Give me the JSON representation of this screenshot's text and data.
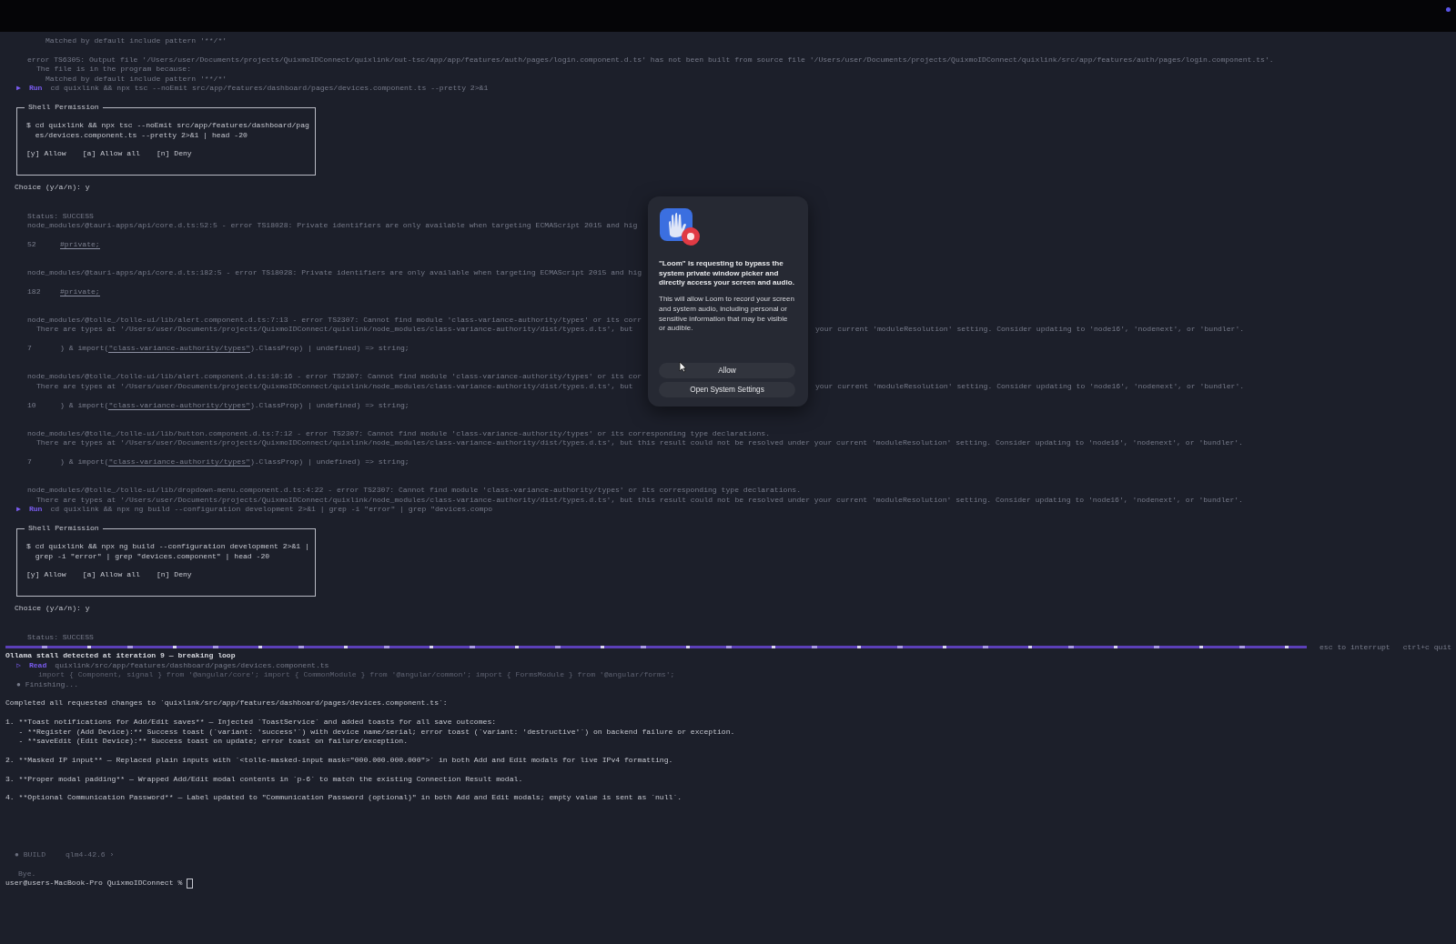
{
  "terminal": {
    "blocks": [
      {
        "kind": "lines",
        "lines": [
          {
            "kind": "out3",
            "text": "Matched by default include pattern '**/*'"
          }
        ]
      },
      {
        "kind": "lines",
        "lines": [
          {
            "kind": "out",
            "text": "error TS6305: Output file '/Users/user/Documents/projects/QuixmoIDConnect/quixlink/out-tsc/app/app/features/auth/pages/login.component.d.ts' has not been built from source file '/Users/user/Documents/projects/QuixmoIDConnect/quixlink/src/app/features/auth/pages/login.component.ts'."
          },
          {
            "kind": "out2",
            "text": "The file is in the program because:"
          },
          {
            "kind": "out3",
            "text": "Matched by default include pattern '**/*'"
          },
          {
            "kind": "run",
            "marker": "▶",
            "label": "Run",
            "text": "cd quixlink && npx tsc --noEmit src/app/features/dashboard/pages/devices.component.ts --pretty 2>&1"
          }
        ]
      },
      {
        "kind": "permission",
        "title": "Shell Permission",
        "command": [
          "$ cd quixlink && npx tsc --noEmit src/app/features/dashboard/pag",
          "  es/devices.component.ts --pretty 2>&1 | head -20"
        ],
        "options": [
          "[y] Allow",
          "[a] Allow all",
          "[n] Deny"
        ],
        "choice": "Choice (y/a/n): y"
      },
      {
        "kind": "lines",
        "lines": [
          {
            "kind": "out",
            "text": "Status: SUCCESS"
          },
          {
            "kind": "out",
            "text": "node_modules/@tauri-apps/api/core.d.ts:52:5 - error TS18028: Private identifiers are only available when targeting ECMAScript 2015 and hig"
          }
        ]
      },
      {
        "kind": "code",
        "lines": [
          {
            "kind": "src",
            "number": "52",
            "mark": "#private;"
          }
        ]
      },
      {
        "kind": "lines",
        "lines": [
          {
            "kind": "out",
            "text": "node_modules/@tauri-apps/api/core.d.ts:182:5 - error TS18028: Private identifiers are only available when targeting ECMAScript 2015 and hig"
          }
        ]
      },
      {
        "kind": "code",
        "lines": [
          {
            "kind": "src",
            "number": "182",
            "mark": "#private;"
          }
        ]
      },
      {
        "kind": "lines",
        "lines": [
          {
            "kind": "out",
            "text": "node_modules/@tolle_/tolle-ui/lib/alert.component.d.ts:7:13 - error TS2307: Cannot find module 'class-variance-authority/types' or its corr"
          },
          {
            "kind": "out2",
            "text": "There are types at '/Users/user/Documents/projects/QuixmoIDConnect/quixlink/node_modules/class-variance-authority/dist/types.d.ts', but",
            "right": "your current 'moduleResolution' setting. Consider updating to 'node16', 'nodenext', or 'bundler'."
          }
        ]
      },
      {
        "kind": "code",
        "lines": [
          {
            "kind": "src",
            "number": "7",
            "pre": ") & import(",
            "mark": "\"class-variance-authority/types\"",
            "post": ").ClassProp) | undefined) => string;"
          }
        ]
      },
      {
        "kind": "lines",
        "lines": [
          {
            "kind": "out",
            "text": "node_modules/@tolle_/tolle-ui/lib/alert.component.d.ts:10:16 - error TS2307: Cannot find module 'class-variance-authority/types' or its cor"
          },
          {
            "kind": "out2",
            "text": "There are types at '/Users/user/Documents/projects/QuixmoIDConnect/quixlink/node_modules/class-variance-authority/dist/types.d.ts', but",
            "right": "your current 'moduleResolution' setting. Consider updating to 'node16', 'nodenext', or 'bundler'."
          }
        ]
      },
      {
        "kind": "code",
        "lines": [
          {
            "kind": "src",
            "number": "10",
            "pre": ") & import(",
            "mark": "\"class-variance-authority/types\"",
            "post": ").ClassProp) | undefined) => string;"
          }
        ]
      },
      {
        "kind": "lines",
        "lines": [
          {
            "kind": "out",
            "text": "node_modules/@tolle_/tolle-ui/lib/button.component.d.ts:7:12 - error TS2307: Cannot find module 'class-variance-authority/types' or its corresponding type declarations."
          },
          {
            "kind": "out2",
            "text": "There are types at '/Users/user/Documents/projects/QuixmoIDConnect/quixlink/node_modules/class-variance-authority/dist/types.d.ts', but this result could not be resolved under your current 'moduleResolution' setting. Consider updating to 'node16', 'nodenext', or 'bundler'."
          }
        ]
      },
      {
        "kind": "code",
        "lines": [
          {
            "kind": "src",
            "number": "7",
            "pre": ") & import(",
            "mark": "\"class-variance-authority/types\"",
            "post": ").ClassProp) | undefined) => string;"
          }
        ]
      },
      {
        "kind": "tight",
        "lines": [
          {
            "kind": "out",
            "text": "node_modules/@tolle_/tolle-ui/lib/dropdown-menu.component.d.ts:4:22 - error TS2307: Cannot find module 'class-variance-authority/types' or its corresponding type declarations."
          },
          {
            "kind": "out2",
            "text": "There are types at '/Users/user/Documents/projects/QuixmoIDConnect/quixlink/node_modules/class-variance-authority/dist/types.d.ts', but this result could not be resolved under your current 'moduleResolution' setting. Consider updating to 'node16', 'nodenext', or 'bundler'."
          },
          {
            "kind": "run",
            "marker": "▶",
            "label": "Run",
            "text": "cd quixlink && npx ng build --configuration development 2>&1 | grep -i \"error\" | grep \"devices.compo"
          }
        ]
      },
      {
        "kind": "permission",
        "title": "Shell Permission",
        "command": [
          "$ cd quixlink && npx ng build --configuration development 2>&1 |",
          "  grep -i \"error\" | grep \"devices.component\" | head -20"
        ],
        "options": [
          "[y] Allow",
          "[a] Allow all",
          "[n] Deny"
        ],
        "choice": "Choice (y/a/n): y"
      },
      {
        "kind": "tight",
        "lines": [
          {
            "kind": "out",
            "text": "Status: SUCCESS"
          }
        ]
      },
      {
        "kind": "progress",
        "hints": [
          "esc to interrupt",
          "ctrl+c quit"
        ]
      },
      {
        "kind": "lines",
        "lines": [
          {
            "kind": "alert",
            "text": "Ollama stall detected at iteration 9 — breaking loop"
          },
          {
            "kind": "run",
            "marker": "▷",
            "label": "Read",
            "text": "quixlink/src/app/features/dashboard/pages/devices.component.ts"
          },
          {
            "kind": "faint",
            "text": "import { Component, signal } from '@angular/core'; import { CommonModule } from '@angular/common'; import { FormsModule } from '@angular/forms';"
          },
          {
            "kind": "step",
            "text": "● Finishing..."
          }
        ]
      },
      {
        "kind": "lines",
        "lines": [
          {
            "kind": "note",
            "text": "Completed all requested changes to `quixlink/src/app/features/dashboard/pages/devices.component.ts`:"
          }
        ]
      },
      {
        "kind": "lines",
        "lines": [
          {
            "kind": "note",
            "text": "1. **Toast notifications for Add/Edit saves** — Injected `ToastService` and added toasts for all save outcomes:"
          },
          {
            "kind": "note",
            "text": "   - **Register (Add Device):** Success toast (`variant: 'success'`) with device name/serial; error toast (`variant: 'destructive'`) on backend failure or exception."
          },
          {
            "kind": "note",
            "text": "   - **saveEdit (Edit Device):** Success toast on update; error toast on failure/exception."
          }
        ]
      },
      {
        "kind": "lines",
        "lines": [
          {
            "kind": "note",
            "text": "2. **Masked IP input** — Replaced plain inputs with `<tolle-masked-input mask=\"000.000.000.000\">` in both Add and Edit modals for live IPv4 formatting."
          }
        ]
      },
      {
        "kind": "lines",
        "lines": [
          {
            "kind": "note",
            "text": "3. **Proper modal padding** — Wrapped Add/Edit modal contents in `p-6` to match the existing Connection Result modal."
          }
        ]
      },
      {
        "kind": "lines",
        "lines": [
          {
            "kind": "note",
            "text": "4. **Optional Communication Password** — Label updated to \"Communication Password (optional)\" in both Add and Edit modals; empty value is sent as `null`."
          }
        ]
      }
    ]
  },
  "status_bar": {
    "mode": "● BUILD",
    "model": "qlm4-42.6 ›"
  },
  "exit_text": "Bye.",
  "prompt": "user@users-MacBook-Pro QuixmoIDConnect %",
  "dialog": {
    "title": "\"Loom\" is requesting to bypass the system private window picker and directly access your screen and audio.",
    "body": "This will allow Loom to record your screen and system audio, including personal or sensitive information that may be visible or audible.",
    "buttons": [
      "Allow",
      "Open System Settings"
    ]
  }
}
